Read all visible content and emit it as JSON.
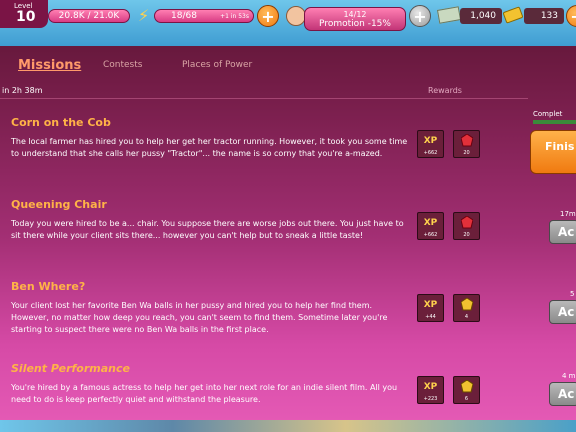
{
  "header": {
    "level_label": "Level",
    "level_value": "10",
    "xp": "20.8K / 21.0K",
    "energy": "18/68",
    "energy_timer": "+1 in 53s",
    "promotion_progress": "14/12",
    "promotion_label": "Promotion -15%",
    "money": "1,040",
    "kobans": "133"
  },
  "tabs": {
    "missions": "Missions",
    "contests": "Contests",
    "places": "Places of Power"
  },
  "timer": "in 2h 38m",
  "rewards_header": "Rewards",
  "missions": [
    {
      "title": "Corn on the Cob",
      "desc": "The local farmer has hired you to help her get her tractor running. However, it took you some time to understand that she calls her pussy \"Tractor\"... the name is so corny that you're a-mazed.",
      "xp_label": "XP",
      "xp_value": "+662",
      "gem_value": "20"
    },
    {
      "title": "Queening Chair",
      "desc": "Today you were hired to be a... chair. You suppose there are worse jobs out there. You just have to sit there while your client sits there... however you can't help but to sneak a little taste!",
      "xp_label": "XP",
      "xp_value": "+662",
      "gem_value": "20"
    },
    {
      "title": "Ben Where?",
      "desc": "Your client lost her favorite Ben Wa balls in her pussy and hired you to help her find them. However, no matter how deep you reach, you can't seem to find them. Sometime later you're starting to suspect there were no Ben Wa balls in the first place.",
      "xp_label": "XP",
      "xp_value": "+44",
      "gem_value": "4"
    },
    {
      "title": "Silent Performance",
      "desc": "You're hired by a famous actress to help her get into her next role for an indie silent film. All you need to do is keep perfectly quiet and withstand the pleasure.",
      "xp_label": "XP",
      "xp_value": "+223",
      "gem_value": "6"
    }
  ],
  "right": {
    "complete_label": "Complet",
    "finish_label": "Finis",
    "times": [
      "17m",
      "5",
      "4 m"
    ],
    "accept_label": "Ac"
  },
  "colors": {
    "accent": "#ffb347",
    "gem_red": "#e2303a",
    "gem_gold": "#f2c230"
  }
}
